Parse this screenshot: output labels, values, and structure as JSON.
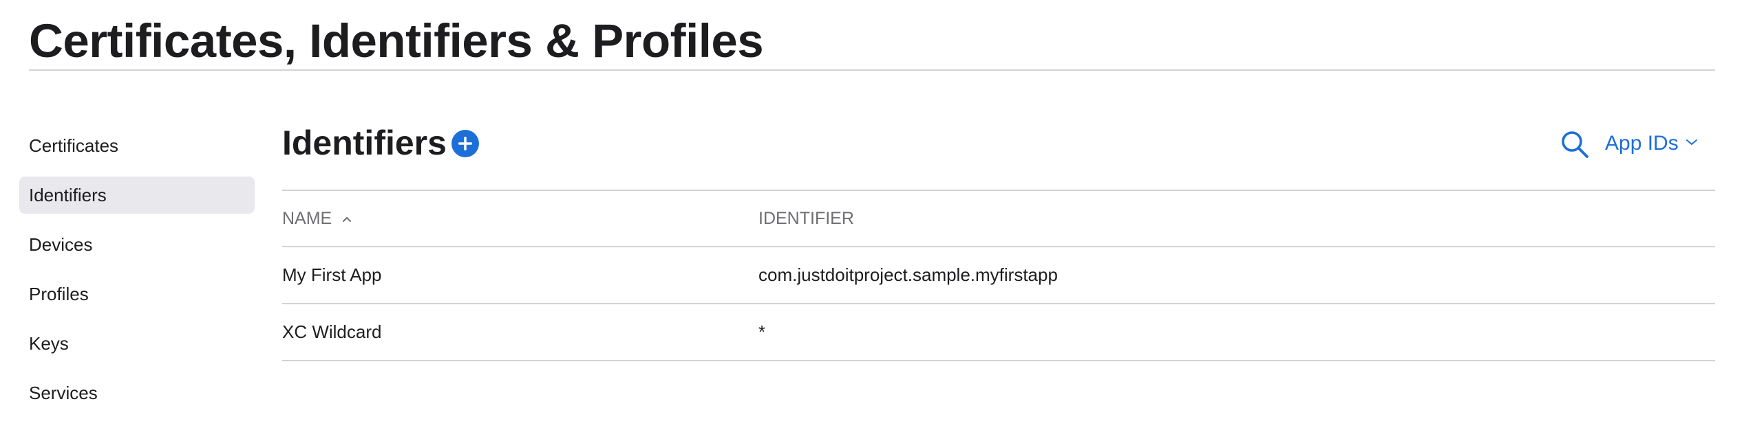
{
  "header": {
    "title": "Certificates, Identifiers & Profiles"
  },
  "sidebar": {
    "items": [
      {
        "label": "Certificates",
        "active": false
      },
      {
        "label": "Identifiers",
        "active": true
      },
      {
        "label": "Devices",
        "active": false
      },
      {
        "label": "Profiles",
        "active": false
      },
      {
        "label": "Keys",
        "active": false
      },
      {
        "label": "Services",
        "active": false
      }
    ]
  },
  "main": {
    "title": "Identifiers",
    "add_icon": "plus-circle-icon",
    "search_icon": "search-icon",
    "filter": {
      "selected": "App IDs",
      "icon": "chevron-down-icon"
    },
    "table": {
      "columns": [
        {
          "label": "NAME",
          "sort": "ascending",
          "sort_icon": "chevron-up-icon"
        },
        {
          "label": "IDENTIFIER"
        }
      ],
      "rows": [
        {
          "name": "My First App",
          "identifier": "com.justdoitproject.sample.myfirstapp"
        },
        {
          "name": "XC Wildcard",
          "identifier": "*"
        }
      ]
    }
  },
  "colors": {
    "accent": "#1d6fd8",
    "text": "#1d1d1f",
    "muted": "#6e6e73",
    "divider": "#d2d2d7",
    "selected_bg": "#e8e8ed"
  }
}
